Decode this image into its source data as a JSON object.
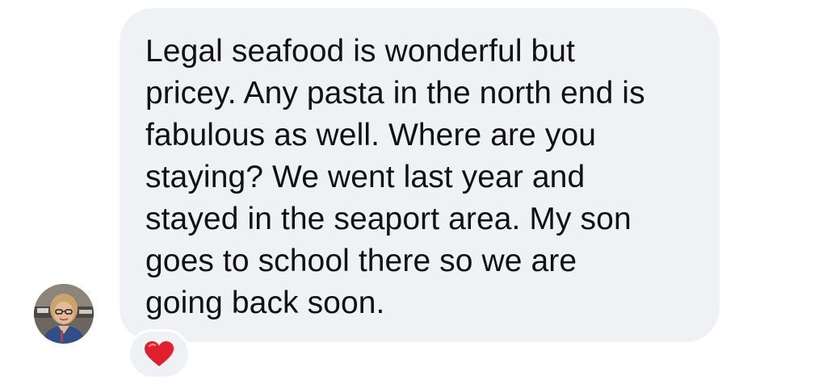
{
  "message": {
    "lines": [
      "Legal seafood is wonderful but",
      "pricey. Any pasta in the north end is",
      "fabulous as well. Where are you",
      "staying? We went last year and",
      "stayed in the seaport area. My son",
      "goes to school there so we are",
      "going back soon."
    ],
    "bubble_color": "#f0f1f5",
    "text_color": "#111111"
  },
  "sender": {
    "avatar_icon": "profile-photo"
  },
  "reaction": {
    "icon": "red-heart-icon",
    "color": "#e0202e"
  }
}
